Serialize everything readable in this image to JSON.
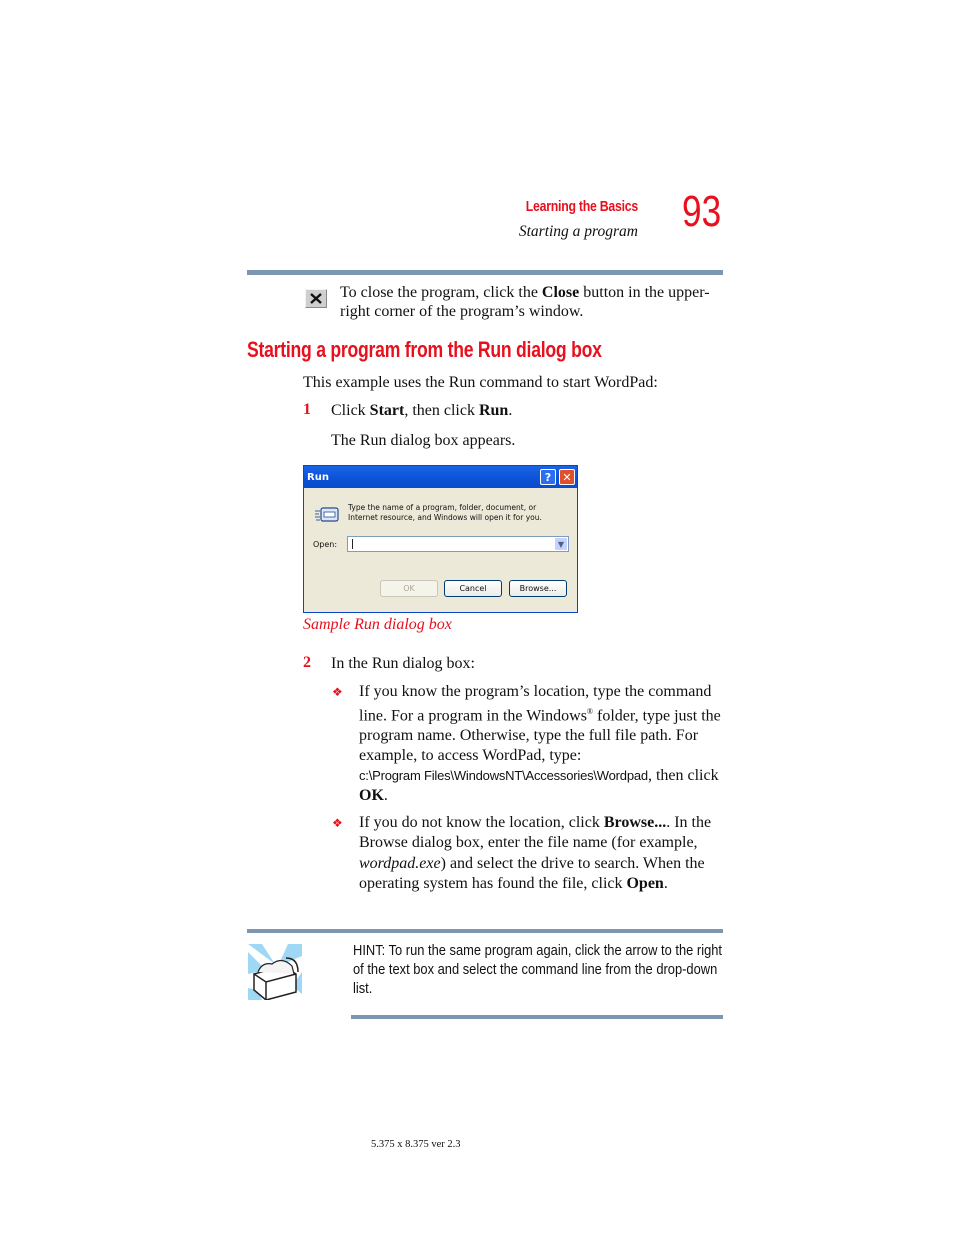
{
  "header": {
    "chapter": "Learning the Basics",
    "section": "Starting a program",
    "page_number": "93"
  },
  "close_note": {
    "icon": "close-x-icon",
    "text_before": "To close the program, click the ",
    "bold": "Close",
    "text_after": " button in the upper-right corner of the program’s window."
  },
  "section_title": "Starting a program from the Run dialog box",
  "intro": "This example uses the Run command to start WordPad:",
  "step1": {
    "number": "1",
    "t1": "Click ",
    "b1": "Start",
    "t2": ", then click ",
    "b2": "Run",
    "t3": ".",
    "result": "The Run dialog box appears."
  },
  "run_dialog": {
    "title": "Run",
    "help_button": "?",
    "close_button": "✕",
    "description_line1": "Type the name of a program, folder, document, or",
    "description_line2": "Internet resource, and Windows will open it for you.",
    "open_label": "Open:",
    "open_value": "",
    "ok_label": "OK",
    "cancel_label": "Cancel",
    "browse_label": "Browse..."
  },
  "caption": "Sample Run dialog box",
  "step2": {
    "number": "2",
    "text": "In the Run dialog box:",
    "bullet_glyph": "❖",
    "bullet1": {
      "t1": "If you know the program’s location, type the command line. For a program in the Windows",
      "sup": "®",
      "t2": " folder, type just the program name. Otherwise, type the full file path. For example, to access WordPad, type:",
      "command": "c:\\Program Files\\WindowsNT\\Accessories\\Wordpad",
      "t3": ", then click ",
      "b": "OK",
      "t4": "."
    },
    "bullet2": {
      "t1": "If you do not know the location, click ",
      "b1": "Browse...",
      "t2": ". In the Browse dialog box, enter the file name (for example, ",
      "i1": "wordpad.exe",
      "t3": ") and select the drive to search. When the operating system has found the file, click ",
      "b2": "Open",
      "t4": "."
    }
  },
  "hint": {
    "icon": "treasure-chest-icon",
    "text": "HINT: To run the same program again, click the arrow to the right of the text box and select the command line from the drop-down list."
  },
  "footer": "5.375 x 8.375 ver 2.3",
  "colors": {
    "accent_red": "#e8101e",
    "rule_blue": "#7d97b2"
  }
}
